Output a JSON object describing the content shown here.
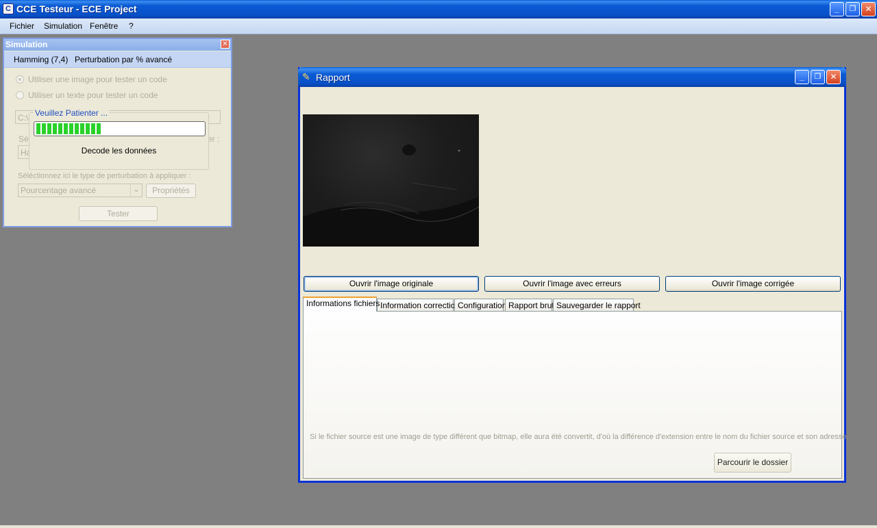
{
  "main_window": {
    "title": "CCE Testeur - ECE Project",
    "icon": "cce-app-icon",
    "controls": {
      "minimize": "_",
      "maximize": "❐",
      "close": "✕"
    }
  },
  "menu": [
    "Fichier",
    "Simulation",
    "Fenêtre",
    "?"
  ],
  "simulation": {
    "title": "Simulation",
    "close": "✕",
    "tabs": [
      "Hamming (7,4)",
      "Perturbation par % avancé"
    ],
    "radio_image": "Utiliser une image pour tester un code",
    "radio_text": "Utiliser un texte pour tester un code",
    "path_field": "C:\\",
    "select_label_partial": "Sél",
    "select_label_tail": "er :",
    "code_field": "Ha",
    "perturbation_label": "Séléctionnez ici le type de perturbation à appliquer :",
    "perturbation_value": "Pourcentage avancé",
    "dropdown_arrow": "⌄",
    "properties_button": "Propriétés",
    "test_button": "Tester",
    "wait": {
      "title": "Veuillez Patienter ...",
      "status": "Decode les données",
      "progress": 0.39
    }
  },
  "rapport": {
    "title": "Rapport",
    "icon": "report-icon",
    "controls": {
      "minimize": "_",
      "maximize": "❐",
      "close": "✕"
    },
    "buttons": {
      "original": "Ouvrir l'image originale",
      "errors": "Ouvrir l'image avec erreurs",
      "corrected": "Ouvrir l'image corrigée"
    },
    "tabs": [
      "Informations fichiers",
      "Information correction",
      "Configuration",
      "Rapport brut",
      "Sauvegarder le rapport"
    ],
    "active_tab": 0,
    "hint": "Si le fichier source est une image de type différent que bitmap, elle aura été convertit, d'où la différence d'extension entre le nom du fichier source et son adresse.",
    "browse_button": "Parcourir le dossier"
  }
}
